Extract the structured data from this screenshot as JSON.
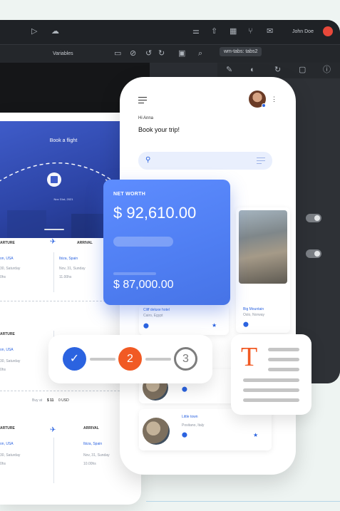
{
  "ide": {
    "variables_label": "Variables",
    "tab_label": "wm-tabs: tabs2",
    "user_label": "John Doe"
  },
  "flight": {
    "hero_title": "Book a flight",
    "hero_date": "Nov 31st, 2021",
    "tickets": [
      {
        "departure_label": "ARTURE",
        "arrival_label": "ARRIVAL",
        "from_city": "on, USA",
        "to_city": "Ibiza, Spain",
        "from_date": "30, Saturday",
        "to_date": "Nov, 31, Sunday",
        "from_time": "0hs",
        "to_time": "11.00hs"
      },
      {
        "departure_label": "ARTURE",
        "arrival_label": "",
        "from_city": "on, USA",
        "to_city": "",
        "from_date": "30, Saturday",
        "to_date": "",
        "from_time": "0hs",
        "to_time": ""
      },
      {
        "departure_label": "ARTURE",
        "arrival_label": "ARRIVAL",
        "from_city": "on, USA",
        "to_city": "Ibiza, Spain",
        "from_date": "30, Saturday",
        "to_date": "Nov, 31, Sunday",
        "from_time": "0hs",
        "to_time": "10.00hs"
      }
    ],
    "buy_prefix": "Buy at",
    "buy_price": "$ 11",
    "buy_currency": "0 USD"
  },
  "phone": {
    "greeting": "Hi Anna",
    "headline": "Book your trip!",
    "destinations": [
      {
        "name": "Cliff deluxe hotel",
        "place": "Cairo, Egypt"
      },
      {
        "name": "Big Mountain",
        "place": "Oslo, Norway"
      },
      {
        "name": "Little town",
        "place": "Positano, Italy"
      }
    ]
  },
  "networth": {
    "label": "NET WORTH",
    "amount": "$ 92,610.00",
    "sub_amount": "$ 87,000.00"
  },
  "stepper": {
    "step2": "2",
    "step3": "3"
  },
  "typecard": {
    "glyph": "T"
  },
  "colors": {
    "accent_blue": "#2b63e0",
    "accent_orange": "#f15a24",
    "networth_blue": "#5e8dff"
  }
}
